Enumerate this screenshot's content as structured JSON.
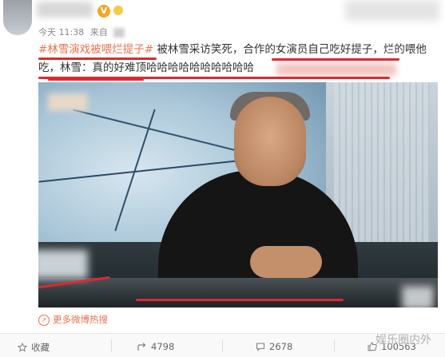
{
  "post": {
    "meta_time": "今天 11:38",
    "meta_from": "来自",
    "hashtag": "#林雪演戏被喂烂提子#",
    "text_part1": " 被林雪采访笑死，合作的女演员自己吃好提子，烂的喂他吃，林雪：真的好难顶哈哈哈哈哈哈哈哈哈哈"
  },
  "more_link": "更多微博热搜",
  "actions": [
    {
      "label": "收藏",
      "icon": "star-icon"
    },
    {
      "label": "4798",
      "icon": "share-icon"
    },
    {
      "label": "2678",
      "icon": "comment-icon"
    },
    {
      "label": "100563",
      "icon": "like-icon"
    }
  ],
  "watermark": "娱乐圈内外",
  "colors": {
    "accent": "#eb7350",
    "underline": "#e0282c"
  }
}
